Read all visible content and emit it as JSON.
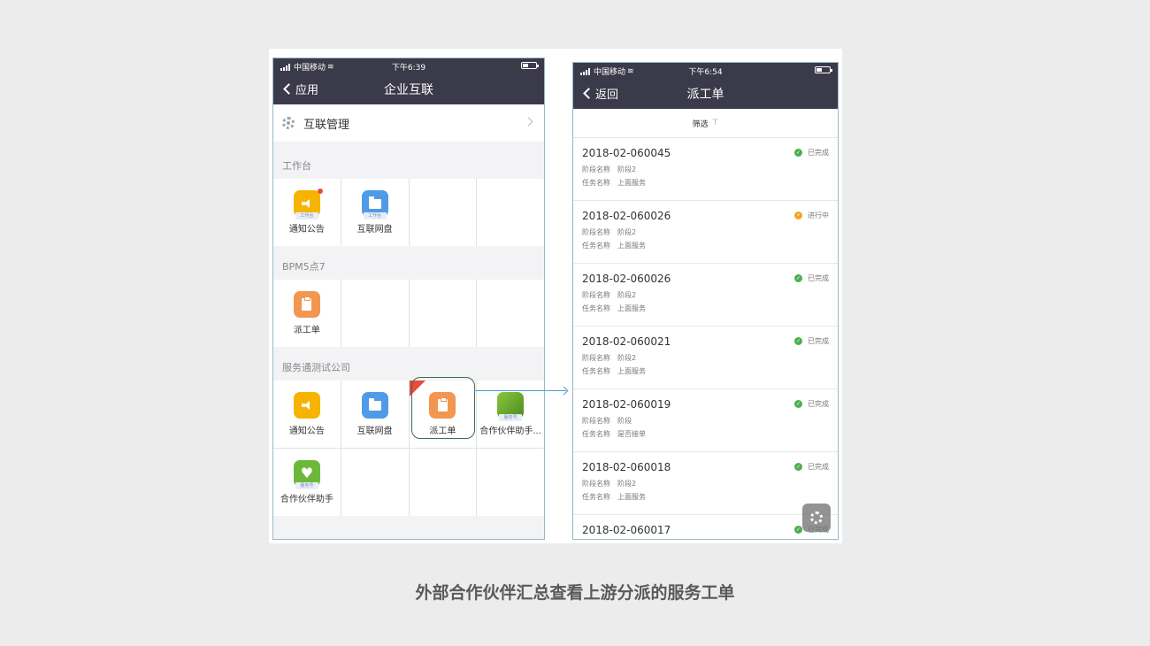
{
  "colors": {
    "navbar": "#3b3a4a",
    "done": "#4caf50",
    "in_progress": "#f5a623",
    "highlight": "#3f6b4f",
    "connector": "#4a9fd0"
  },
  "left_phone": {
    "status_bar": {
      "carrier": "中国移动",
      "time": "下午6:39"
    },
    "nav": {
      "back_label": "应用",
      "title": "企业互联"
    },
    "management_row": {
      "label": "互联管理",
      "icon": "gear-icon"
    },
    "sections": [
      {
        "title": "工作台",
        "apps": [
          {
            "label": "通知公告",
            "icon": "speaker-icon",
            "tag": "工作台"
          },
          {
            "label": "互联网盘",
            "icon": "folder-icon",
            "tag": "工作台"
          }
        ]
      },
      {
        "title": "BPM5点7",
        "apps": [
          {
            "label": "派工单",
            "icon": "clipboard-icon"
          }
        ]
      },
      {
        "title": "服务通测试公司",
        "apps": [
          {
            "label": "通知公告",
            "icon": "speaker-icon"
          },
          {
            "label": "互联网盘",
            "icon": "folder-icon"
          },
          {
            "label": "派工单",
            "icon": "clipboard-icon"
          },
          {
            "label": "合作伙伴助手...",
            "icon": "partner-photo-icon",
            "tag": "服务号"
          },
          {
            "label": "合作伙伴助手",
            "icon": "heart-icon",
            "tag": "服务号"
          }
        ]
      }
    ]
  },
  "right_phone": {
    "status_bar": {
      "carrier": "中国移动",
      "time": "下午6:54"
    },
    "nav": {
      "back_label": "返回",
      "title": "派工单"
    },
    "filter_label": "筛选",
    "field_labels": {
      "stage": "阶段名称",
      "task": "任务名称"
    },
    "orders": [
      {
        "id": "2018-02-060045",
        "stage": "阶段2",
        "task": "上面服务",
        "status": "已完成",
        "state": "done"
      },
      {
        "id": "2018-02-060026",
        "stage": "阶段2",
        "task": "上面服务",
        "status": "进行中",
        "state": "doing"
      },
      {
        "id": "2018-02-060026",
        "stage": "阶段2",
        "task": "上面服务",
        "status": "已完成",
        "state": "done"
      },
      {
        "id": "2018-02-060021",
        "stage": "阶段2",
        "task": "上面服务",
        "status": "已完成",
        "state": "done"
      },
      {
        "id": "2018-02-060019",
        "stage": "阶段",
        "task": "是否接单",
        "status": "已完成",
        "state": "done"
      },
      {
        "id": "2018-02-060018",
        "stage": "阶段2",
        "task": "上面服务",
        "status": "已完成",
        "state": "done"
      },
      {
        "id": "2018-02-060017",
        "stage": "",
        "task": "",
        "status": "已完成",
        "state": "done"
      }
    ]
  },
  "caption": "外部合作伙伴汇总查看上游分派的服务工单"
}
